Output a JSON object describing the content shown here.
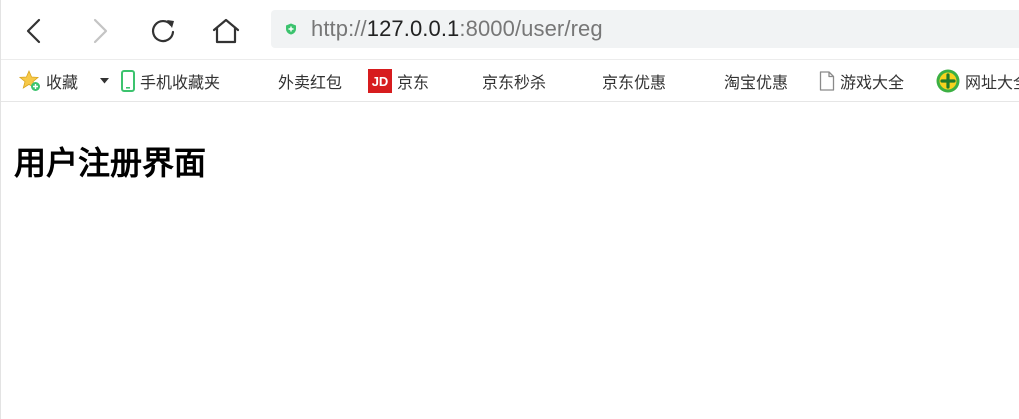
{
  "browser": {
    "url_protocol": "http://",
    "url_host": "127.0.0.1",
    "url_rest": ":8000/user/reg",
    "secure_icon": "shield-icon",
    "colors": {
      "address_bar_bg": "#f1f3f4",
      "secure_icon": "#3cc36e"
    }
  },
  "bookmarks": {
    "items": [
      {
        "label": "收藏",
        "icon": "star-icon"
      },
      {
        "label": "手机收藏夹",
        "icon": "phone-icon"
      },
      {
        "label": "外卖红包",
        "icon": ""
      },
      {
        "label": "京东",
        "icon": "jd-logo-icon"
      },
      {
        "label": "京东秒杀",
        "icon": ""
      },
      {
        "label": "京东优惠",
        "icon": ""
      },
      {
        "label": "淘宝优惠",
        "icon": ""
      },
      {
        "label": "游戏大全",
        "icon": "page-icon"
      },
      {
        "label": "网址大全",
        "icon": "green-plus-icon"
      }
    ],
    "jd_logo_text": "JD"
  },
  "page": {
    "heading": "用户注册界面"
  }
}
